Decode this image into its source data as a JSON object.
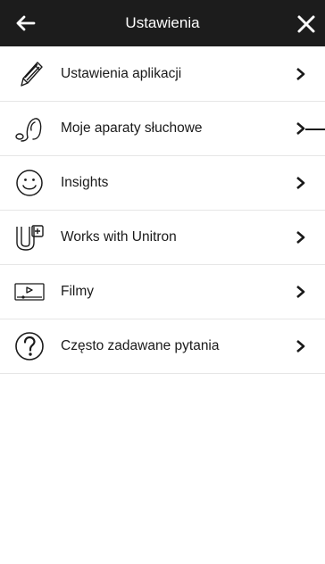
{
  "header": {
    "title": "Ustawienia",
    "back_icon": "arrow-left-icon",
    "close_icon": "close-icon"
  },
  "menu": {
    "items": [
      {
        "label": "Ustawienia aplikacji",
        "icon": "pencil-icon"
      },
      {
        "label": "Moje aparaty słuchowe",
        "icon": "hearing-aid-icon"
      },
      {
        "label": "Insights",
        "icon": "smiley-icon"
      },
      {
        "label": "Works with Unitron",
        "icon": "unitron-icon"
      },
      {
        "label": "Filmy",
        "icon": "video-icon"
      },
      {
        "label": "Często zadawane pytania",
        "icon": "question-icon"
      }
    ]
  },
  "colors": {
    "header_bg": "#1c1c1c",
    "header_text": "#ffffff",
    "divider": "#e6e6e6"
  }
}
